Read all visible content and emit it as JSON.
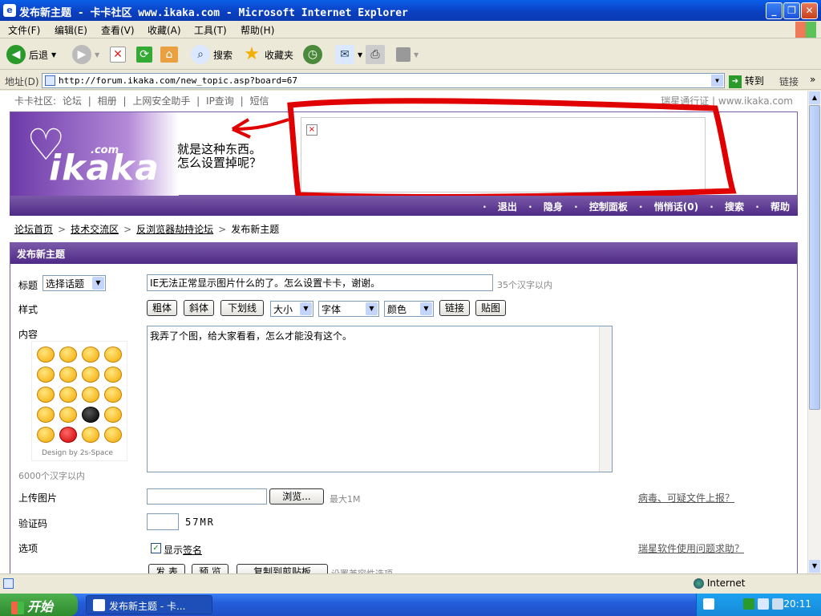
{
  "window": {
    "title": "发布新主题 - 卡卡社区 www.ikaka.com - Microsoft Internet Explorer"
  },
  "menu": [
    "文件(F)",
    "编辑(E)",
    "查看(V)",
    "收藏(A)",
    "工具(T)",
    "帮助(H)"
  ],
  "toolbar": {
    "back": "后退",
    "search": "搜索",
    "favorites": "收藏夹"
  },
  "address": {
    "label": "地址(D)",
    "url": "http://forum.ikaka.com/new_topic.asp?board=67",
    "go": "转到",
    "links": "链接"
  },
  "site": {
    "topnav": [
      "卡卡社区:",
      "论坛",
      "|",
      "相册",
      "|",
      "上网安全助手",
      "|",
      "IP查询",
      "|",
      "短信"
    ],
    "topright": "瑞星通行证 | www.ikaka.com",
    "logo_text": "ikaka",
    "logo_com": ".com",
    "banner_line1": "就是这种东西。",
    "banner_line2": "怎么设置掉呢？",
    "ad_broken": "×",
    "nav": [
      "退出",
      "隐身",
      "控制面板",
      "悄悄话(0)",
      "搜索",
      "帮助"
    ]
  },
  "breadcrumb": [
    "论坛首页",
    "技术交流区",
    "反浏览器劫持论坛",
    "发布新主题"
  ],
  "form": {
    "panel_title": "发布新主题",
    "title_label": "标题",
    "topic_select": "选择话题",
    "title_value": "IE无法正常显示图片什么的了。怎么设置卡卡，谢谢。",
    "title_hint": "35个汉字以内",
    "style_label": "样式",
    "style_buttons": [
      "粗体",
      "斜体",
      "下划线"
    ],
    "size_select": "大小",
    "font_select": "字体",
    "color_select": "颜色",
    "link_button": "链接",
    "image_button": "贴图",
    "content_label": "内容",
    "content_value": "我弄了个图，给大家看看，怎么才能没有这个。",
    "smiley_caption": "Design by 2s-Space",
    "content_hint": "6000个汉字以内",
    "upload_label": "上传图片",
    "browse_button": "浏览...",
    "upload_hint": "最大1M",
    "report_link": "病毒、可疑文件上报？",
    "captcha_label": "验证码",
    "captcha_code": "57MR",
    "options_label": "选项",
    "show_sig_prefix": "显示",
    "show_sig_link": "签名",
    "help_link": "瑞星软件使用问题求助？",
    "submit_buttons": [
      "发 表",
      "预 览",
      "复制到剪贴板"
    ],
    "partial_hint": "设置兼容性选项"
  },
  "status": {
    "zone": "Internet"
  },
  "taskbar": {
    "start": "开始",
    "task": "发布新主题 - 卡...",
    "clock": "20:11"
  }
}
